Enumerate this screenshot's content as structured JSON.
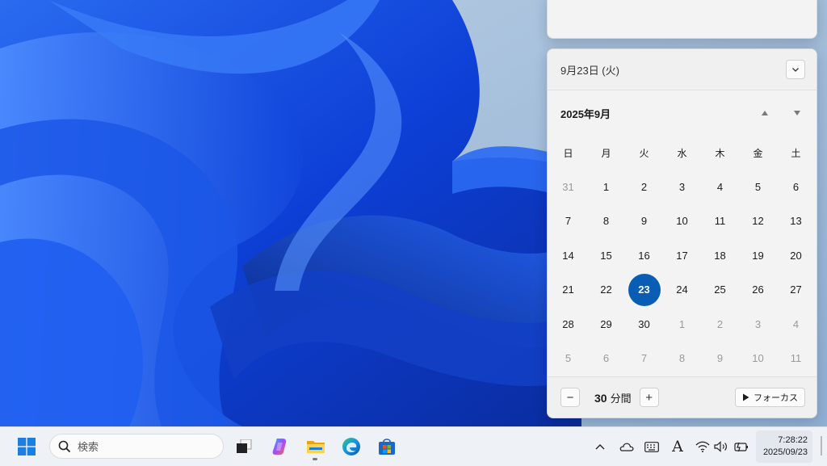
{
  "calendar": {
    "date_label": "9月23日 (火)",
    "month_title": "2025年9月",
    "weekdays": [
      "日",
      "月",
      "火",
      "水",
      "木",
      "金",
      "土"
    ],
    "weeks": [
      [
        {
          "d": "31",
          "o": true
        },
        {
          "d": "1"
        },
        {
          "d": "2"
        },
        {
          "d": "3"
        },
        {
          "d": "4"
        },
        {
          "d": "5"
        },
        {
          "d": "6"
        }
      ],
      [
        {
          "d": "7"
        },
        {
          "d": "8"
        },
        {
          "d": "9"
        },
        {
          "d": "10"
        },
        {
          "d": "11"
        },
        {
          "d": "12"
        },
        {
          "d": "13"
        }
      ],
      [
        {
          "d": "14"
        },
        {
          "d": "15"
        },
        {
          "d": "16"
        },
        {
          "d": "17"
        },
        {
          "d": "18"
        },
        {
          "d": "19"
        },
        {
          "d": "20"
        }
      ],
      [
        {
          "d": "21"
        },
        {
          "d": "22"
        },
        {
          "d": "23",
          "t": true
        },
        {
          "d": "24"
        },
        {
          "d": "25"
        },
        {
          "d": "26"
        },
        {
          "d": "27"
        }
      ],
      [
        {
          "d": "28"
        },
        {
          "d": "29"
        },
        {
          "d": "30"
        },
        {
          "d": "1",
          "o": true
        },
        {
          "d": "2",
          "o": true
        },
        {
          "d": "3",
          "o": true
        },
        {
          "d": "4",
          "o": true
        }
      ],
      [
        {
          "d": "5",
          "o": true
        },
        {
          "d": "6",
          "o": true
        },
        {
          "d": "7",
          "o": true
        },
        {
          "d": "8",
          "o": true
        },
        {
          "d": "9",
          "o": true
        },
        {
          "d": "10",
          "o": true
        },
        {
          "d": "11",
          "o": true
        }
      ]
    ],
    "today_color": "#0a5db5"
  },
  "focus": {
    "minus": "−",
    "minutes_value": "30",
    "minutes_unit": "分間",
    "plus": "+",
    "focus_button": "フォーカス"
  },
  "taskbar": {
    "search_placeholder": "検索",
    "apps": [
      "start-icon",
      "task-view-icon",
      "copilot-icon",
      "file-explorer-icon",
      "edge-icon",
      "store-icon"
    ],
    "tray_icons": [
      "chevron-up-icon",
      "onedrive-icon",
      "keyboard-icon",
      "ime-icon",
      "wifi-icon",
      "volume-icon",
      "battery-icon"
    ],
    "ime_label": "A",
    "clock_time": "7:28:22",
    "clock_date": "2025/09/23"
  }
}
